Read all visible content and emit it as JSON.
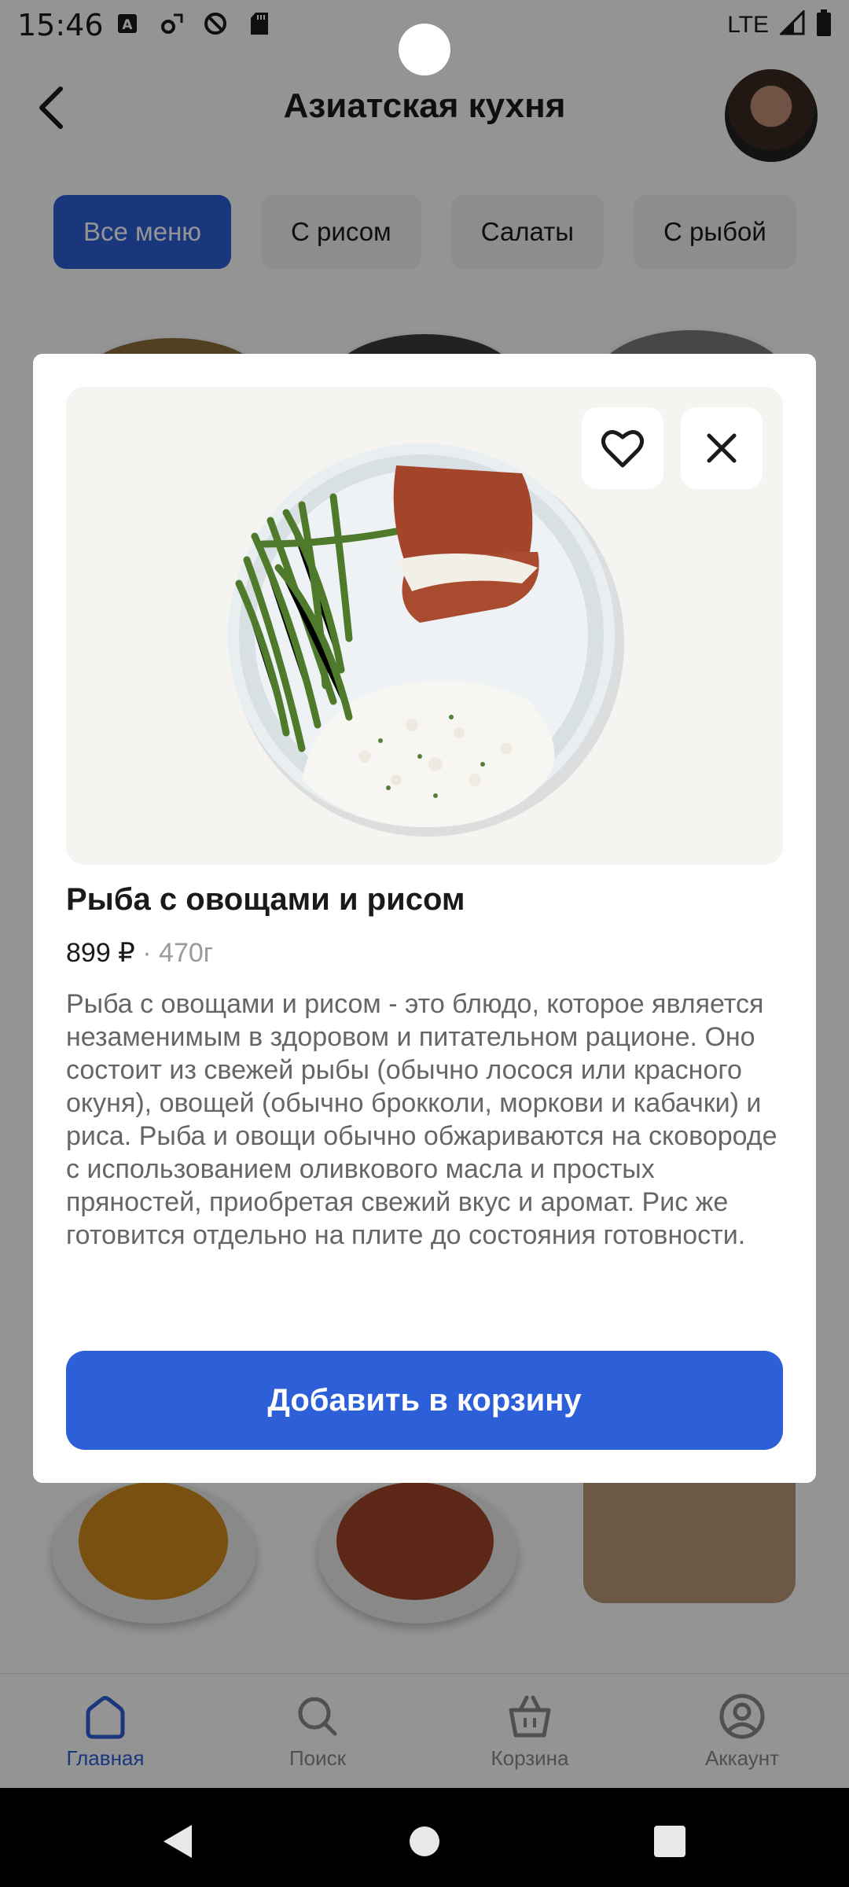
{
  "status_bar": {
    "time": "15:46",
    "network": "LTE"
  },
  "header": {
    "title": "Азиатская кухня"
  },
  "chips": [
    {
      "label": "Все меню",
      "active": true
    },
    {
      "label": "С рисом",
      "active": false
    },
    {
      "label": "Салаты",
      "active": false
    },
    {
      "label": "С рыбой",
      "active": false
    }
  ],
  "modal": {
    "dish_name": "Рыба с овощами и рисом",
    "price": "899 ₽",
    "weight": "· 470г",
    "description": "Рыба с овощами и рисом - это блюдо, которое является незаменимым в здоровом и питательном рационе. Оно состоит из свежей рыбы (обычно лосося или красного окуня), овощей (обычно брокколи, моркови и кабачки) и риса. Рыба и овощи обычно обжариваются на сковороде с использованием оливкового масла и простых пряностей, приобретая свежий вкус и аромат. Рис же готовится отдельно на плите до состояния готовности.",
    "add_to_cart": "Добавить в корзину"
  },
  "bottom_nav": [
    {
      "label": "Главная",
      "icon": "home-icon",
      "active": true
    },
    {
      "label": "Поиск",
      "icon": "search-icon",
      "active": false
    },
    {
      "label": "Корзина",
      "icon": "basket-icon",
      "active": false
    },
    {
      "label": "Аккаунт",
      "icon": "account-icon",
      "active": false
    }
  ],
  "colors": {
    "accent": "#2d5fd8",
    "overlay": "rgba(0,0,0,0.42)"
  }
}
